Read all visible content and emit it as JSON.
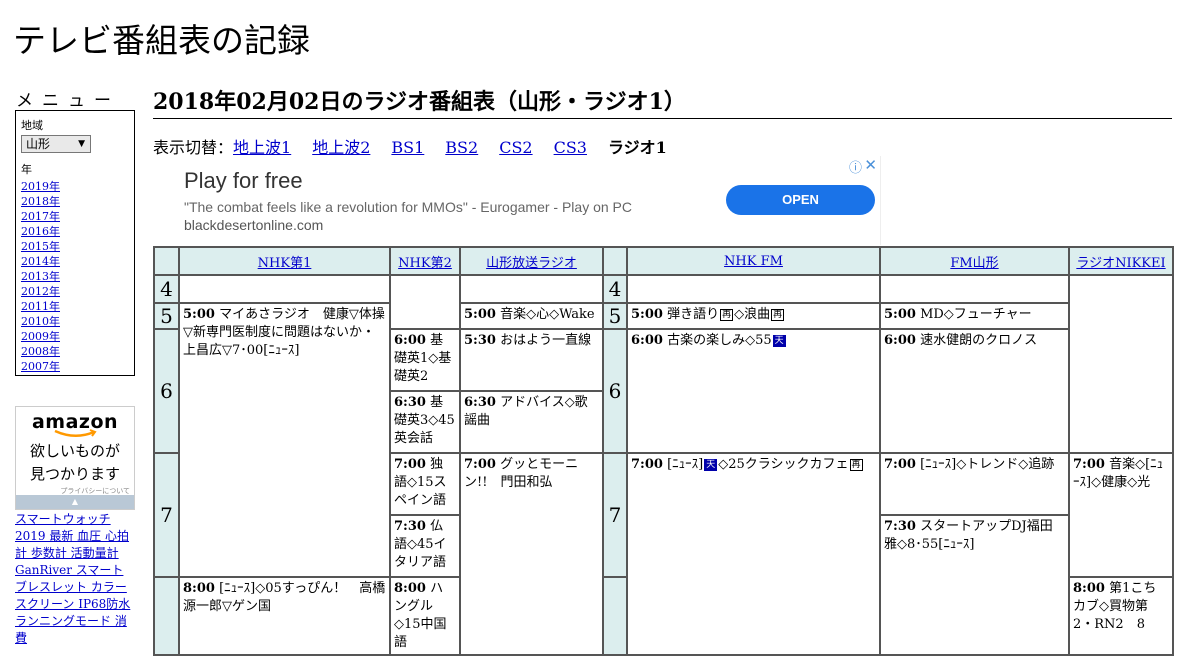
{
  "site": {
    "title": "テレビ番組表の記録"
  },
  "sidebar": {
    "menu_heading": "メニュー",
    "region_label": "地域",
    "region_selected": "山形",
    "year_label": "年",
    "years": [
      "2019年",
      "2018年",
      "2017年",
      "2016年",
      "2015年",
      "2014年",
      "2013年",
      "2012年",
      "2011年",
      "2010年",
      "2009年",
      "2008年",
      "2007年"
    ],
    "amazon": {
      "logo": "amazon",
      "text_line1": "欲しいものが",
      "text_line2": "見つかります",
      "privacy": "プライバシーについて"
    },
    "product_link": "スマートウォッチ 2019 最新 血圧 心拍計 歩数計 活動量計 GanRiver スマートブレスレット カラースクリーン IP68防水 ランニングモード 消費"
  },
  "main": {
    "page_title": "2018年02月02日のラジオ番組表（山形・ラジオ1）",
    "switch_label": "表示切替：",
    "switch_links": [
      "地上波1",
      "地上波2",
      "BS1",
      "BS2",
      "CS2",
      "CS3"
    ],
    "switch_current": "ラジオ1"
  },
  "ad": {
    "title": "Play for free",
    "description": "\"The combat feels like a revolution for MMOs\" - Eurogamer - Play on PC",
    "url": "blackdesertonline.com",
    "button": "OPEN",
    "info_icon": "info-icon",
    "close_icon": "close-icon"
  },
  "schedule": {
    "channels": [
      "NHK第1",
      "NHK第2",
      "山形放送ラジオ",
      "NHK FM",
      "FM山形",
      "ラジオNIKKEI"
    ],
    "hours": [
      "4",
      "5",
      "6",
      "7"
    ],
    "programs": {
      "nhk1_500_time": "5:00",
      "nhk1_500_title": "マイあさラジオ　健康▽体操▽新専門医制度に問題はないか・上昌広▽7･00[ﾆｭｰｽ]",
      "nhk1_800_time": "8:00",
      "nhk1_800_title": "[ﾆｭｰｽ]◇05すっぴん！　高橋源一郎▽ゲン国",
      "nhk2_600_time": "6:00",
      "nhk2_600_title": "基礎英1◇基礎英2",
      "nhk2_630_time": "6:30",
      "nhk2_630_title": "基礎英3◇45英会話",
      "nhk2_700_time": "7:00",
      "nhk2_700_title": "独語◇15スペイン語",
      "nhk2_730_time": "7:30",
      "nhk2_730_title": "仏語◇45イタリア語",
      "nhk2_800_time": "8:00",
      "nhk2_800_title": "ハングル◇15中国語",
      "ybc_500_time": "5:00",
      "ybc_500_title": "音楽◇心◇Wake",
      "ybc_530_time": "5:30",
      "ybc_530_title": "おはよう一直線",
      "ybc_630_time": "6:30",
      "ybc_630_title": "アドバイス◇歌謡曲",
      "ybc_700_time": "7:00",
      "ybc_700_title": "グッとモーニン!!　門田和弘",
      "fm_500_time": "5:00",
      "fm_500_title": "弾き語り",
      "fm_500_mid": "◇浪曲",
      "fm_600_time": "6:00",
      "fm_600_title": "古楽の楽しみ◇55",
      "fm_700_time": "7:00",
      "fm_700_pre": "[ﾆｭｰｽ]",
      "fm_700_title": "◇25クラシックカフェ",
      "fmy_500_time": "5:00",
      "fmy_500_title": "MD◇フューチャー",
      "fmy_600_time": "6:00",
      "fmy_600_title": "速水健朗のクロノス",
      "fmy_700_time": "7:00",
      "fmy_700_title": "[ﾆｭｰｽ]◇トレンド◇追跡",
      "fmy_730_time": "7:30",
      "fmy_730_title": "スタートアップDJ福田雅◇8･55[ﾆｭｰｽ]",
      "nikkei_700_time": "7:00",
      "nikkei_700_title": "音楽◇[ﾆｭｰｽ]◇健康◇光",
      "nikkei_800_time": "8:00",
      "nikkei_800_title": "第1こちカブ◇買物第2・RN2　8"
    },
    "badges": {
      "re": "再",
      "ten": "天"
    }
  }
}
